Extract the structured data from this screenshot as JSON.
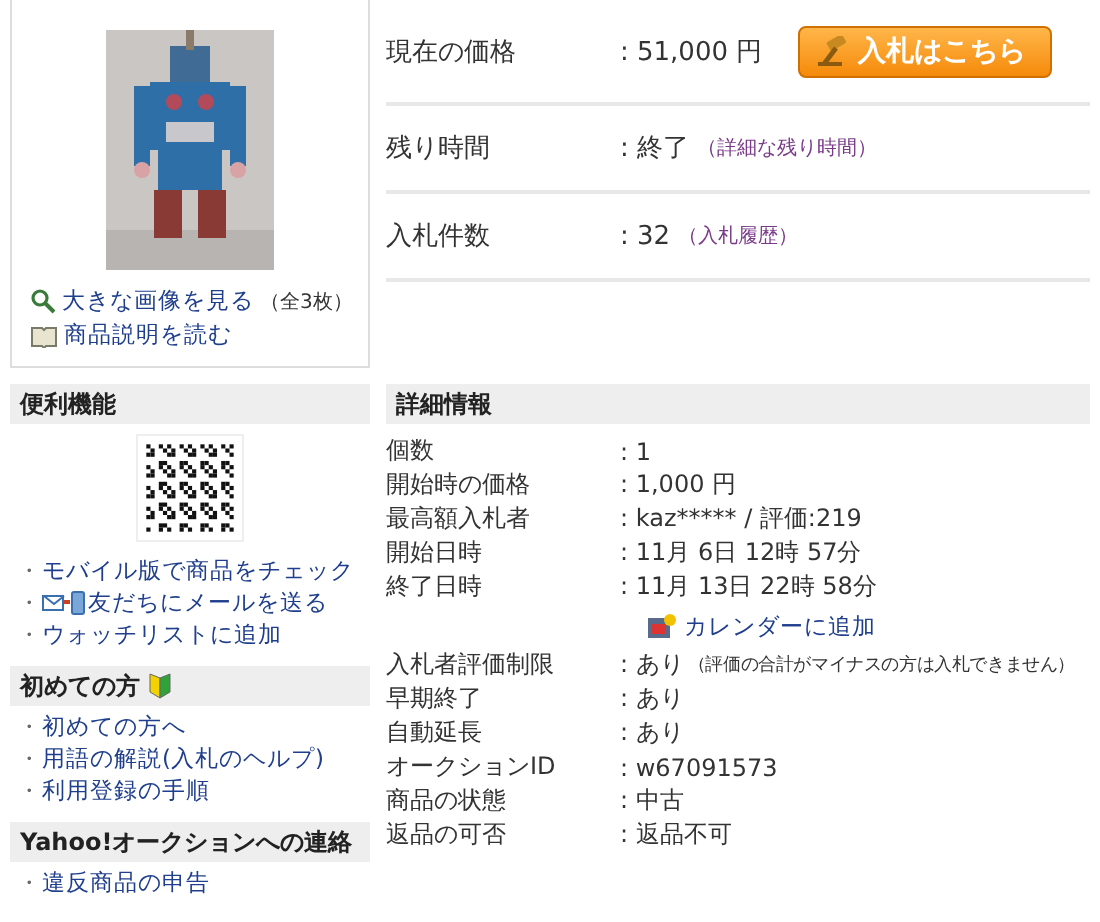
{
  "item_image": {
    "links": [
      {
        "kind": "zoom",
        "text": "大きな画像を見る",
        "note": "（全3枚）"
      },
      {
        "kind": "book",
        "text": "商品説明を読む"
      }
    ]
  },
  "summary": {
    "rows": [
      {
        "label": "現在の価格",
        "value": ": 51,000 円",
        "button": "入札はこちら"
      },
      {
        "label": "残り時間",
        "value": ": 終了",
        "link": "（詳細な残り時間）"
      },
      {
        "label": "入札件数",
        "value": ": 32",
        "link": "（入札履歴）"
      }
    ]
  },
  "side_sections": [
    {
      "kind": "qr",
      "title": "便利機能",
      "links": [
        {
          "bullet": "・",
          "text": "モバイル版で商品をチェック",
          "kind": "plain"
        },
        {
          "bullet": "・",
          "text": "友だちにメールを送る",
          "kind": "mail"
        },
        {
          "bullet": "・",
          "text": "ウォッチリストに追加",
          "kind": "plain"
        }
      ]
    },
    {
      "kind": "beginner",
      "title": "初めての方",
      "links": [
        {
          "bullet": "・",
          "text": "初めての方へ",
          "kind": "plain"
        },
        {
          "bullet": "・",
          "text": "用語の解説(入札のヘルプ)",
          "kind": "plain"
        },
        {
          "bullet": "・",
          "text": "利用登録の手順",
          "kind": "plain"
        }
      ]
    },
    {
      "kind": "plain",
      "title": "Yahoo!オークションへの連絡",
      "links": [
        {
          "bullet": "・",
          "text": "違反商品の申告",
          "kind": "plain"
        }
      ]
    }
  ],
  "details": {
    "title": "詳細情報",
    "rows": [
      {
        "kind": "row",
        "label": "個数",
        "value": ": 1"
      },
      {
        "kind": "row",
        "label": "開始時の価格",
        "value": ": 1,000 円"
      },
      {
        "kind": "row",
        "label": "最高額入札者",
        "value": ": kaz***** / 評価:219"
      },
      {
        "kind": "row",
        "label": "開始日時",
        "value": ": 11月 6日 12時 57分"
      },
      {
        "kind": "row",
        "label": "終了日時",
        "value": ": 11月 13日 22時 58分"
      },
      {
        "kind": "calendar",
        "text": "カレンダーに追加"
      },
      {
        "kind": "row",
        "label": "入札者評価制限",
        "value": ": あり",
        "note": "（評価の合計がマイナスの方は入札できません）"
      },
      {
        "kind": "row",
        "label": "早期終了",
        "value": ": あり"
      },
      {
        "kind": "row",
        "label": "自動延長",
        "value": ": あり"
      },
      {
        "kind": "row",
        "label": "オークションID",
        "value": ": w67091573"
      },
      {
        "kind": "row",
        "label": "商品の状態",
        "value": ": 中古"
      },
      {
        "kind": "row",
        "label": "返品の可否",
        "value": ": 返品不可"
      }
    ]
  }
}
